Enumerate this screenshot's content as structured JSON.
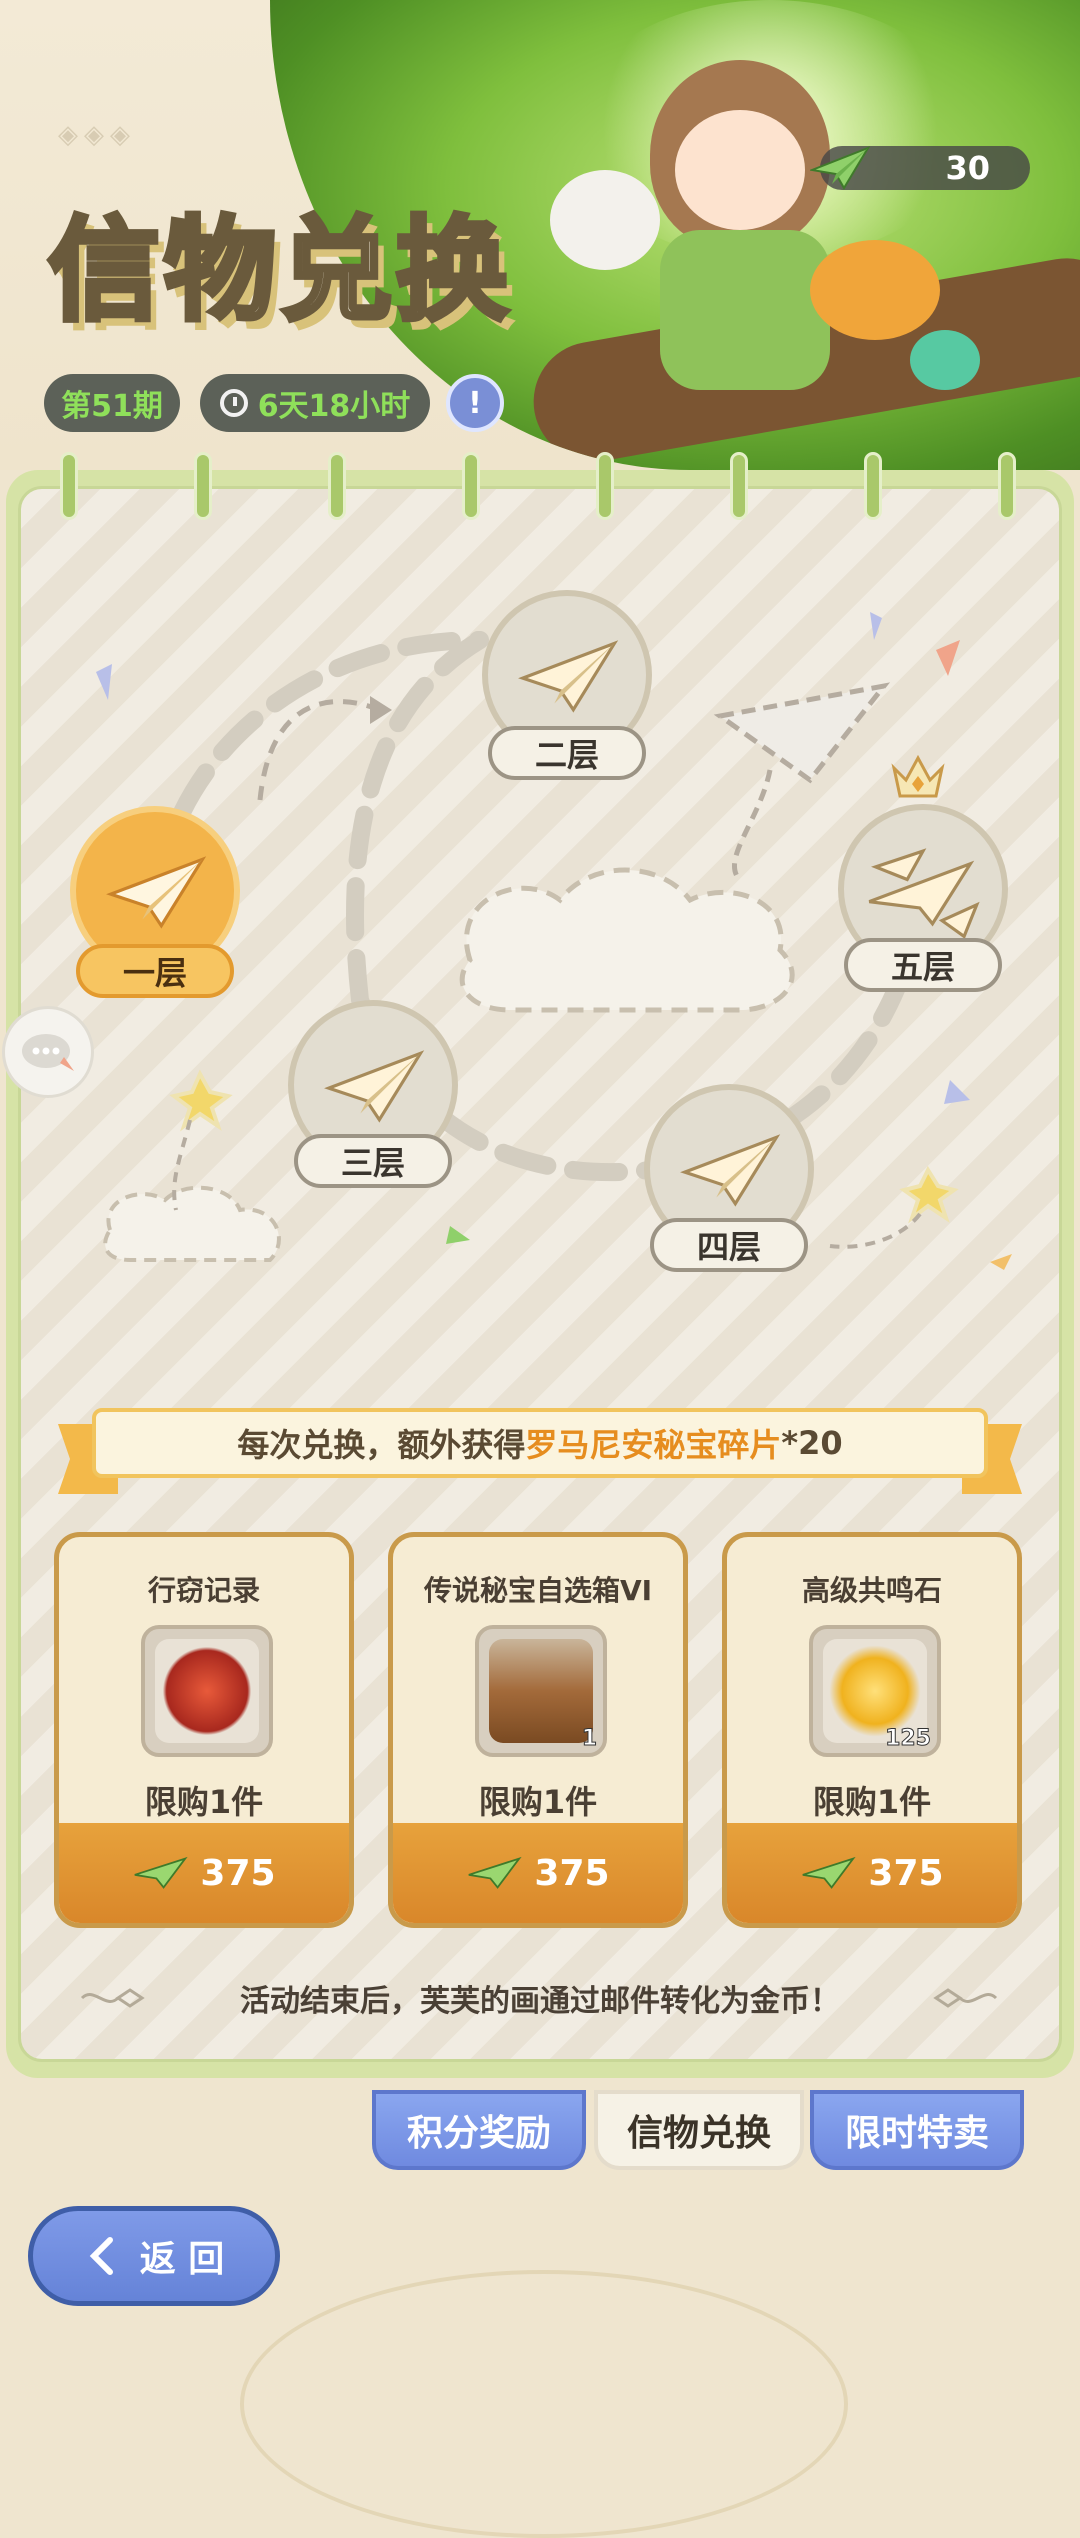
{
  "header": {
    "title": "信物兑换",
    "period": "第51期",
    "countdown": "6天18小时",
    "info_icon": "book-icon",
    "currency_amount": "30",
    "currency_icon": "paper-plane-icon"
  },
  "floors": [
    {
      "label": "一层",
      "state": "current"
    },
    {
      "label": "二层",
      "state": "locked"
    },
    {
      "label": "三层",
      "state": "locked"
    },
    {
      "label": "四层",
      "state": "locked"
    },
    {
      "label": "五层",
      "state": "final"
    }
  ],
  "banner": {
    "prefix": "每次兑换，额外获得",
    "highlight": "罗马尼安秘宝碎片",
    "suffix": "*20"
  },
  "shop": [
    {
      "name": "行窃记录",
      "qty": "",
      "limit": "限购1件",
      "price": "375",
      "icon": "record-icon"
    },
    {
      "name": "传说秘宝自选箱VI",
      "qty": "1",
      "limit": "限购1件",
      "price": "375",
      "icon": "chest-icon"
    },
    {
      "name": "高级共鸣石",
      "qty": "125",
      "limit": "限购1件",
      "price": "375",
      "icon": "gem-icon"
    }
  ],
  "footer_note": "活动结束后，芙芙的画通过邮件转化为金币！",
  "tabs": [
    {
      "label": "积分奖励",
      "selected": false
    },
    {
      "label": "信物兑换",
      "selected": true
    },
    {
      "label": "限时特卖",
      "selected": false
    }
  ],
  "back_label": "返 回",
  "colors": {
    "accent_orange": "#e68d1f",
    "tab_blue": "#7a95e6",
    "panel_green": "#c8d797",
    "pill_text_green": "#8fe05a"
  }
}
